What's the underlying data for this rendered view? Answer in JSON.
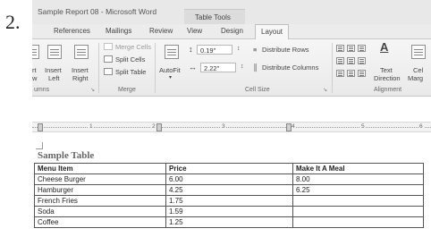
{
  "step_number": "2.",
  "window": {
    "title": "Sample Report 08 - Microsoft Word",
    "context_tab_group": "Table Tools"
  },
  "tabs": [
    {
      "label": "References",
      "active": false
    },
    {
      "label": "Mailings",
      "active": false
    },
    {
      "label": "Review",
      "active": false
    },
    {
      "label": "View",
      "active": false
    },
    {
      "label": "Design",
      "active": false
    },
    {
      "label": "Layout",
      "active": true
    }
  ],
  "ribbon": {
    "rows_columns": {
      "insert_below": [
        "rt",
        "w"
      ],
      "insert_left": [
        "Insert",
        "Left"
      ],
      "insert_right": [
        "Insert",
        "Right"
      ],
      "group_label": "umns"
    },
    "merge": {
      "merge_cells": "Merge Cells",
      "split_cells": "Split Cells",
      "split_table": "Split Table",
      "group_label": "Merge"
    },
    "cell_size": {
      "autofit": "AutoFit",
      "height_value": "0.19\"",
      "width_value": "2.22\"",
      "distribute_rows": "Distribute Rows",
      "distribute_columns": "Distribute Columns",
      "group_label": "Cell Size"
    },
    "alignment": {
      "text_direction": [
        "Text",
        "Direction"
      ],
      "cell_margins": [
        "Cel",
        "Marg"
      ],
      "group_label": "Alignment"
    }
  },
  "ruler": {
    "numbers": [
      "1",
      "2",
      "3",
      "4",
      "5",
      "6"
    ]
  },
  "document": {
    "table_title": "Sample Table",
    "table": {
      "headers": [
        "Menu Item",
        "Price",
        "Make It A Meal"
      ],
      "rows": [
        [
          "Cheese Burger",
          "6.00",
          "8.00"
        ],
        [
          "Hamburger",
          "4.25",
          "6.25"
        ],
        [
          "French Fries",
          "1.75",
          ""
        ],
        [
          "Soda",
          "1.59",
          ""
        ],
        [
          "Coffee",
          "1.25",
          ""
        ]
      ]
    }
  }
}
